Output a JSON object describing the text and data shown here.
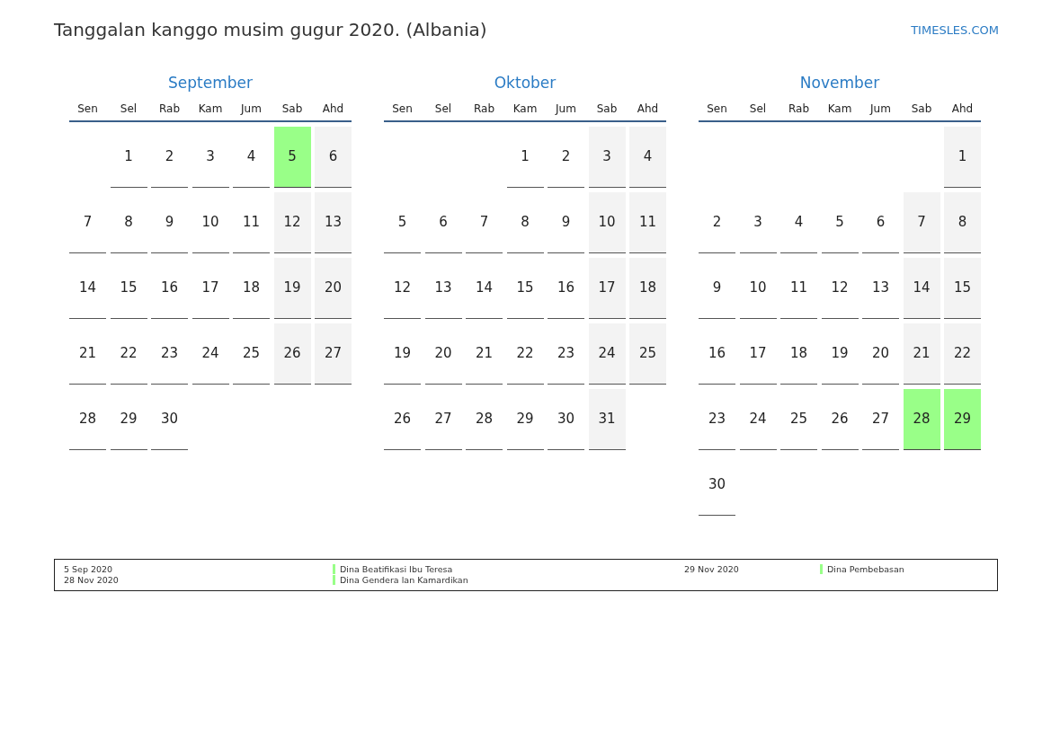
{
  "title": "Tanggalan kanggo musim gugur 2020. (Albania)",
  "site_link": "TIMESLES.COM",
  "months": [
    {
      "name": "September",
      "weekdays": [
        "Sen",
        "Sel",
        "Rab",
        "Kam",
        "Jum",
        "Sab",
        "Ahd"
      ],
      "weeks": [
        [
          {
            "kind": "blank"
          },
          {
            "day": "1",
            "kind": "day"
          },
          {
            "day": "2",
            "kind": "day"
          },
          {
            "day": "3",
            "kind": "day"
          },
          {
            "day": "4",
            "kind": "day"
          },
          {
            "day": "5",
            "kind": "holiday"
          },
          {
            "day": "6",
            "kind": "weekend"
          }
        ],
        [
          {
            "day": "7",
            "kind": "day"
          },
          {
            "day": "8",
            "kind": "day"
          },
          {
            "day": "9",
            "kind": "day"
          },
          {
            "day": "10",
            "kind": "day"
          },
          {
            "day": "11",
            "kind": "day"
          },
          {
            "day": "12",
            "kind": "weekend"
          },
          {
            "day": "13",
            "kind": "weekend"
          }
        ],
        [
          {
            "day": "14",
            "kind": "day"
          },
          {
            "day": "15",
            "kind": "day"
          },
          {
            "day": "16",
            "kind": "day"
          },
          {
            "day": "17",
            "kind": "day"
          },
          {
            "day": "18",
            "kind": "day"
          },
          {
            "day": "19",
            "kind": "weekend"
          },
          {
            "day": "20",
            "kind": "weekend"
          }
        ],
        [
          {
            "day": "21",
            "kind": "day"
          },
          {
            "day": "22",
            "kind": "day"
          },
          {
            "day": "23",
            "kind": "day"
          },
          {
            "day": "24",
            "kind": "day"
          },
          {
            "day": "25",
            "kind": "day"
          },
          {
            "day": "26",
            "kind": "weekend"
          },
          {
            "day": "27",
            "kind": "weekend"
          }
        ],
        [
          {
            "day": "28",
            "kind": "day"
          },
          {
            "day": "29",
            "kind": "day"
          },
          {
            "day": "30",
            "kind": "day"
          }
        ]
      ]
    },
    {
      "name": "Oktober",
      "weekdays": [
        "Sen",
        "Sel",
        "Rab",
        "Kam",
        "Jum",
        "Sab",
        "Ahd"
      ],
      "weeks": [
        [
          {
            "kind": "blank"
          },
          {
            "kind": "blank"
          },
          {
            "kind": "blank"
          },
          {
            "day": "1",
            "kind": "day"
          },
          {
            "day": "2",
            "kind": "day"
          },
          {
            "day": "3",
            "kind": "weekend"
          },
          {
            "day": "4",
            "kind": "weekend"
          }
        ],
        [
          {
            "day": "5",
            "kind": "day"
          },
          {
            "day": "6",
            "kind": "day"
          },
          {
            "day": "7",
            "kind": "day"
          },
          {
            "day": "8",
            "kind": "day"
          },
          {
            "day": "9",
            "kind": "day"
          },
          {
            "day": "10",
            "kind": "weekend"
          },
          {
            "day": "11",
            "kind": "weekend"
          }
        ],
        [
          {
            "day": "12",
            "kind": "day"
          },
          {
            "day": "13",
            "kind": "day"
          },
          {
            "day": "14",
            "kind": "day"
          },
          {
            "day": "15",
            "kind": "day"
          },
          {
            "day": "16",
            "kind": "day"
          },
          {
            "day": "17",
            "kind": "weekend"
          },
          {
            "day": "18",
            "kind": "weekend"
          }
        ],
        [
          {
            "day": "19",
            "kind": "day"
          },
          {
            "day": "20",
            "kind": "day"
          },
          {
            "day": "21",
            "kind": "day"
          },
          {
            "day": "22",
            "kind": "day"
          },
          {
            "day": "23",
            "kind": "day"
          },
          {
            "day": "24",
            "kind": "weekend"
          },
          {
            "day": "25",
            "kind": "weekend"
          }
        ],
        [
          {
            "day": "26",
            "kind": "day"
          },
          {
            "day": "27",
            "kind": "day"
          },
          {
            "day": "28",
            "kind": "day"
          },
          {
            "day": "29",
            "kind": "day"
          },
          {
            "day": "30",
            "kind": "day"
          },
          {
            "day": "31",
            "kind": "weekend"
          }
        ]
      ]
    },
    {
      "name": "November",
      "weekdays": [
        "Sen",
        "Sel",
        "Rab",
        "Kam",
        "Jum",
        "Sab",
        "Ahd"
      ],
      "weeks": [
        [
          {
            "kind": "blank"
          },
          {
            "kind": "blank"
          },
          {
            "kind": "blank"
          },
          {
            "kind": "blank"
          },
          {
            "kind": "blank"
          },
          {
            "kind": "blank"
          },
          {
            "day": "1",
            "kind": "weekend"
          }
        ],
        [
          {
            "day": "2",
            "kind": "day"
          },
          {
            "day": "3",
            "kind": "day"
          },
          {
            "day": "4",
            "kind": "day"
          },
          {
            "day": "5",
            "kind": "day"
          },
          {
            "day": "6",
            "kind": "day"
          },
          {
            "day": "7",
            "kind": "weekend"
          },
          {
            "day": "8",
            "kind": "weekend"
          }
        ],
        [
          {
            "day": "9",
            "kind": "day"
          },
          {
            "day": "10",
            "kind": "day"
          },
          {
            "day": "11",
            "kind": "day"
          },
          {
            "day": "12",
            "kind": "day"
          },
          {
            "day": "13",
            "kind": "day"
          },
          {
            "day": "14",
            "kind": "weekend"
          },
          {
            "day": "15",
            "kind": "weekend"
          }
        ],
        [
          {
            "day": "16",
            "kind": "day"
          },
          {
            "day": "17",
            "kind": "day"
          },
          {
            "day": "18",
            "kind": "day"
          },
          {
            "day": "19",
            "kind": "day"
          },
          {
            "day": "20",
            "kind": "day"
          },
          {
            "day": "21",
            "kind": "weekend"
          },
          {
            "day": "22",
            "kind": "weekend"
          }
        ],
        [
          {
            "day": "23",
            "kind": "day"
          },
          {
            "day": "24",
            "kind": "day"
          },
          {
            "day": "25",
            "kind": "day"
          },
          {
            "day": "26",
            "kind": "day"
          },
          {
            "day": "27",
            "kind": "day"
          },
          {
            "day": "28",
            "kind": "holiday"
          },
          {
            "day": "29",
            "kind": "holiday"
          }
        ],
        [
          {
            "day": "30",
            "kind": "day"
          }
        ]
      ]
    }
  ],
  "legend": [
    {
      "dates": [
        "5 Sep 2020",
        "28 Nov 2020"
      ],
      "names": [
        "Dina Beatifikasi Ibu Teresa",
        "Dina Gendera lan Kamardikan"
      ]
    },
    {
      "dates": [
        "29 Nov 2020"
      ],
      "names": [
        "Dina Pembebasan"
      ]
    }
  ]
}
